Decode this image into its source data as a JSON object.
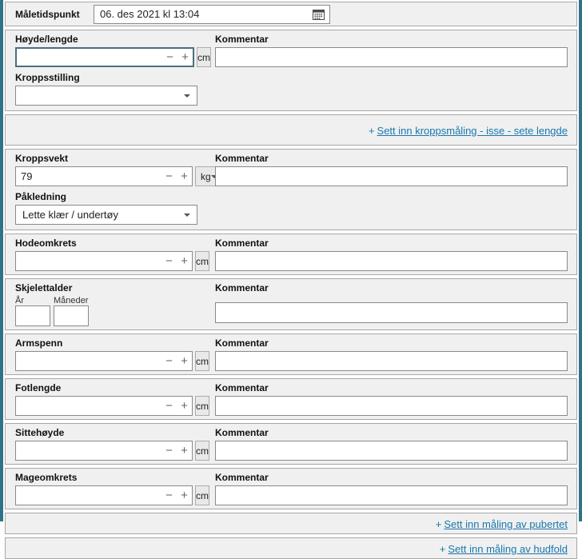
{
  "theme": {
    "frame_teal": "#2e7386",
    "section_bg": "#f0f0f0",
    "section_border": "#a7a7a7",
    "link_blue": "#1878ad",
    "focus_border": "#4c6e7f"
  },
  "measurement_time": {
    "label": "Måletidspunkt",
    "value": "06. des 2021 kl 13:04",
    "icon": "calendar-icon"
  },
  "controls": {
    "minus": "−",
    "plus": "+"
  },
  "comment": {
    "label": "Kommentar",
    "value": ""
  },
  "fields": {
    "hoyde": {
      "label": "Høyde/lengde",
      "value": "",
      "unit": "cm"
    },
    "kroppsstilling": {
      "label": "Kroppsstilling",
      "value": ""
    },
    "kroppsvekt": {
      "label": "Kroppsvekt",
      "value": "79",
      "unit": "kg"
    },
    "pakledning": {
      "label": "Påkledning",
      "value": "Lette klær / undertøy"
    },
    "hodeomkrets": {
      "label": "Hodeomkrets",
      "value": "",
      "unit": "cm"
    },
    "skjelettalder": {
      "label": "Skjelettalder",
      "year_label": "År",
      "months_label": "Måneder",
      "year_value": "",
      "months_value": ""
    },
    "armspenn": {
      "label": "Armspenn",
      "value": "",
      "unit": "cm"
    },
    "fotlengde": {
      "label": "Fotlengde",
      "value": "",
      "unit": "cm"
    },
    "sittehoyde": {
      "label": "Sittehøyde",
      "value": "",
      "unit": "cm"
    },
    "mageomkrets": {
      "label": "Mageomkrets",
      "value": "",
      "unit": "cm"
    }
  },
  "links": {
    "kroppsmaling": {
      "prefix": "+",
      "label": "Sett inn kroppsmåling - isse - sete lengde"
    },
    "pubertet": {
      "prefix": "+",
      "label": "Sett inn måling av pubertet"
    },
    "hudfold": {
      "prefix": "+",
      "label": "Sett inn måling av hudfold"
    }
  }
}
